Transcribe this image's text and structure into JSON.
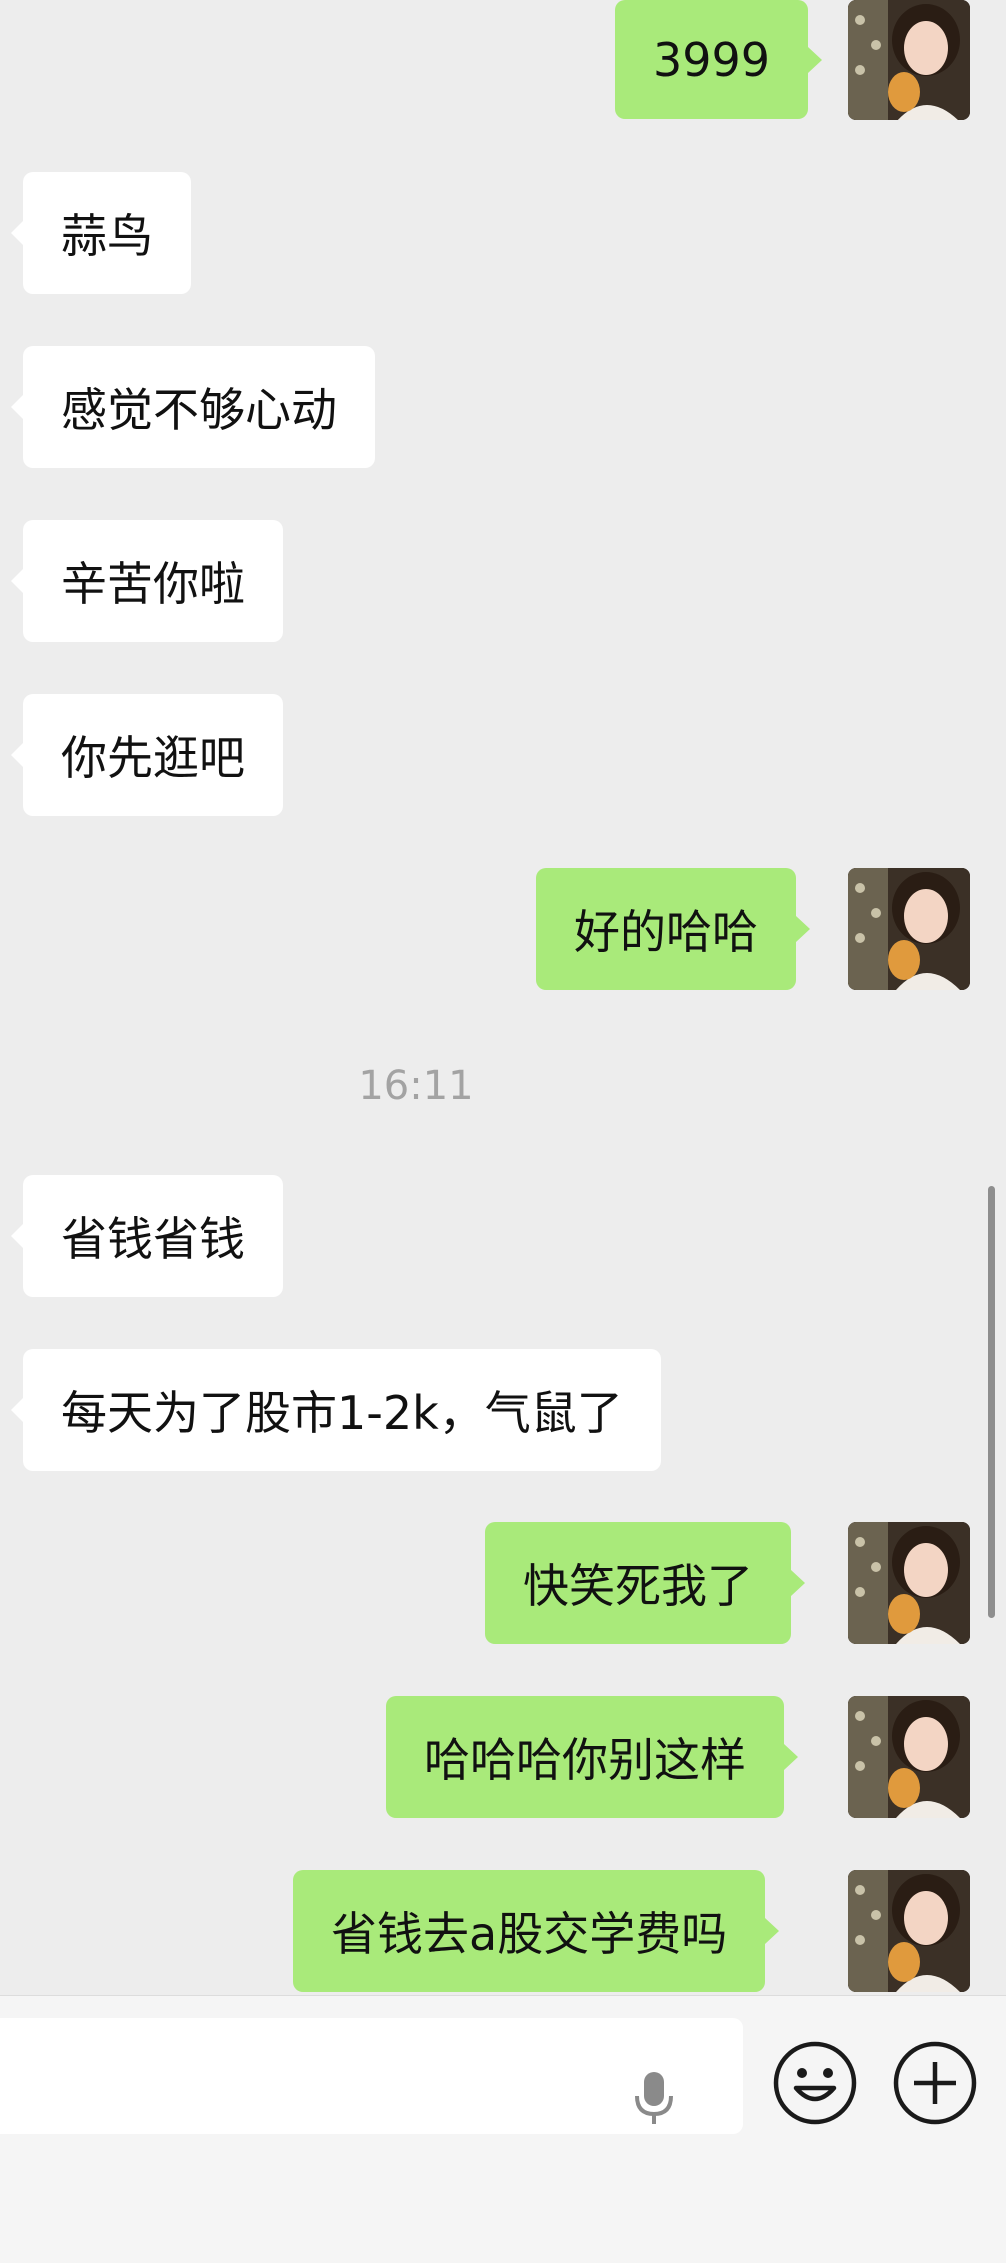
{
  "messages": [
    {
      "side": "out",
      "text": "3999"
    },
    {
      "side": "in",
      "text": "蒜鸟"
    },
    {
      "side": "in",
      "text": "感觉不够心动"
    },
    {
      "side": "in",
      "text": "辛苦你啦"
    },
    {
      "side": "in",
      "text": "你先逛吧"
    },
    {
      "side": "out",
      "text": "好的哈哈"
    },
    {
      "side": "in",
      "text": "省钱省钱"
    },
    {
      "side": "in",
      "text": "每天为了股市1-2k，气鼠了"
    },
    {
      "side": "out",
      "text": "快笑死我了"
    },
    {
      "side": "out",
      "text": "哈哈哈你别这样"
    },
    {
      "side": "out",
      "text": "省钱去a股交学费吗"
    }
  ],
  "timestamp": "16:11",
  "composer": {
    "input_value": "",
    "voice_icon": "microphone-icon",
    "emoji_icon": "smiley-icon",
    "more_icon": "plus-icon"
  },
  "colors": {
    "background": "#ededed",
    "outgoing_bubble": "#a9ea7a",
    "incoming_bubble": "#ffffff"
  }
}
